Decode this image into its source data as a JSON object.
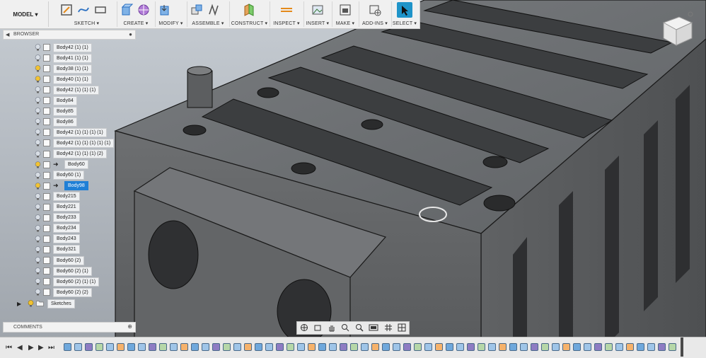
{
  "toolbar": {
    "mode_label": "MODEL",
    "groups": [
      {
        "label": "SKETCH ▾"
      },
      {
        "label": "CREATE ▾"
      },
      {
        "label": "MODIFY ▾"
      },
      {
        "label": "ASSEMBLE ▾"
      },
      {
        "label": "CONSTRUCT ▾"
      },
      {
        "label": "INSPECT ▾"
      },
      {
        "label": "INSERT ▾"
      },
      {
        "label": "MAKE ▾"
      },
      {
        "label": "ADD-INS ▾"
      },
      {
        "label": "SELECT ▾"
      }
    ]
  },
  "browser": {
    "title": "BROWSER",
    "items": [
      {
        "label": "Body42 (1) (1)"
      },
      {
        "label": "Body41 (1) (1)"
      },
      {
        "label": "Body38 (1) (1)"
      },
      {
        "label": "Body40 (1) (1)"
      },
      {
        "label": "Body42 (1) (1) (1)"
      },
      {
        "label": "Body84"
      },
      {
        "label": "Body85"
      },
      {
        "label": "Body86"
      },
      {
        "label": "Body42 (1) (1) (1) (1)"
      },
      {
        "label": "Body42 (1) (1) (1) (1) (1)"
      },
      {
        "label": "Body42 (1) (1) (1) (2)"
      },
      {
        "label": "Body60"
      },
      {
        "label": "Body60 (1)"
      },
      {
        "label": "Body98"
      },
      {
        "label": "Body215"
      },
      {
        "label": "Body221"
      },
      {
        "label": "Body233"
      },
      {
        "label": "Body234"
      },
      {
        "label": "Body243"
      },
      {
        "label": "Body321"
      },
      {
        "label": "Body60 (2)"
      },
      {
        "label": "Body60 (2) (1)"
      },
      {
        "label": "Body60 (2) (1) (1)"
      },
      {
        "label": "Body60 (2) (2)"
      }
    ],
    "sketches_label": "Sketches"
  },
  "comments": {
    "title": "COMMENTS"
  },
  "colors": {
    "selection": "#1f7fd6",
    "model_gray": "#6b6b6b",
    "toolbar_bg": "#f0f0f0"
  }
}
